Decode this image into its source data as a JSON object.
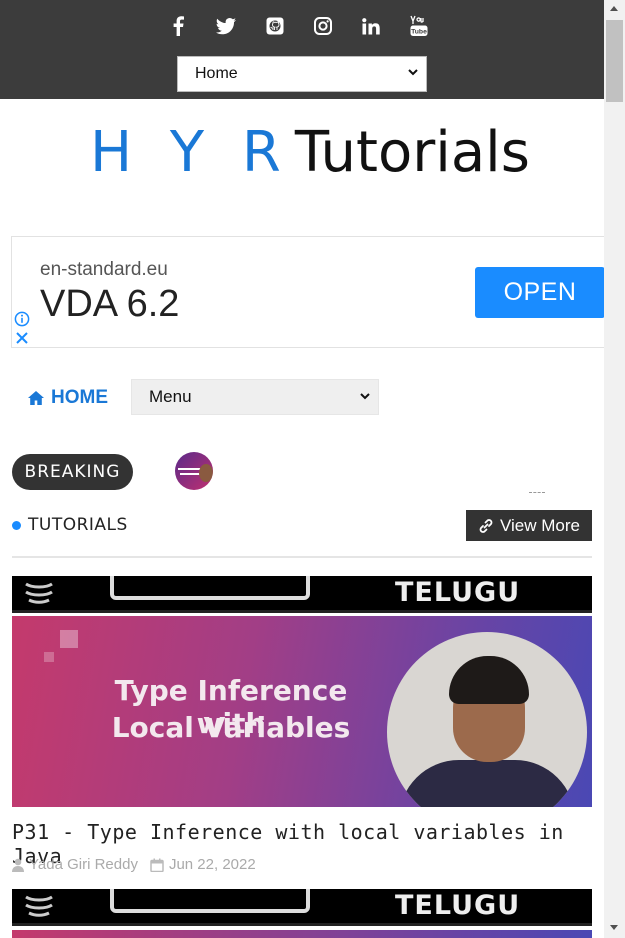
{
  "header": {
    "social_icons": [
      "facebook-icon",
      "twitter-icon",
      "github-icon",
      "instagram-icon",
      "linkedin-icon",
      "youtube-icon"
    ],
    "select_value": "Home"
  },
  "logo": {
    "part1": "H Y R",
    "part2": "Tutorials"
  },
  "ad": {
    "domain": "en-standard.eu",
    "headline": "VDA 6.2",
    "cta": "OPEN"
  },
  "nav": {
    "home_label": "HOME",
    "menu_value": "Menu"
  },
  "breaking": {
    "label": "BREAKING"
  },
  "section": {
    "title": "TUTORIALS",
    "view_more": "View More"
  },
  "posts": [
    {
      "strip_text": "TELUGU",
      "banner_line1": "Type Inference with",
      "banner_line2": "Local Variables",
      "title": "P31 - Type Inference with local variables in Java",
      "author": "Yada Giri Reddy",
      "date": "Jun 22, 2022"
    },
    {
      "strip_text": "TELUGU"
    }
  ],
  "colors": {
    "accent": "#1a8cff",
    "dark": "#3c3c3c"
  }
}
